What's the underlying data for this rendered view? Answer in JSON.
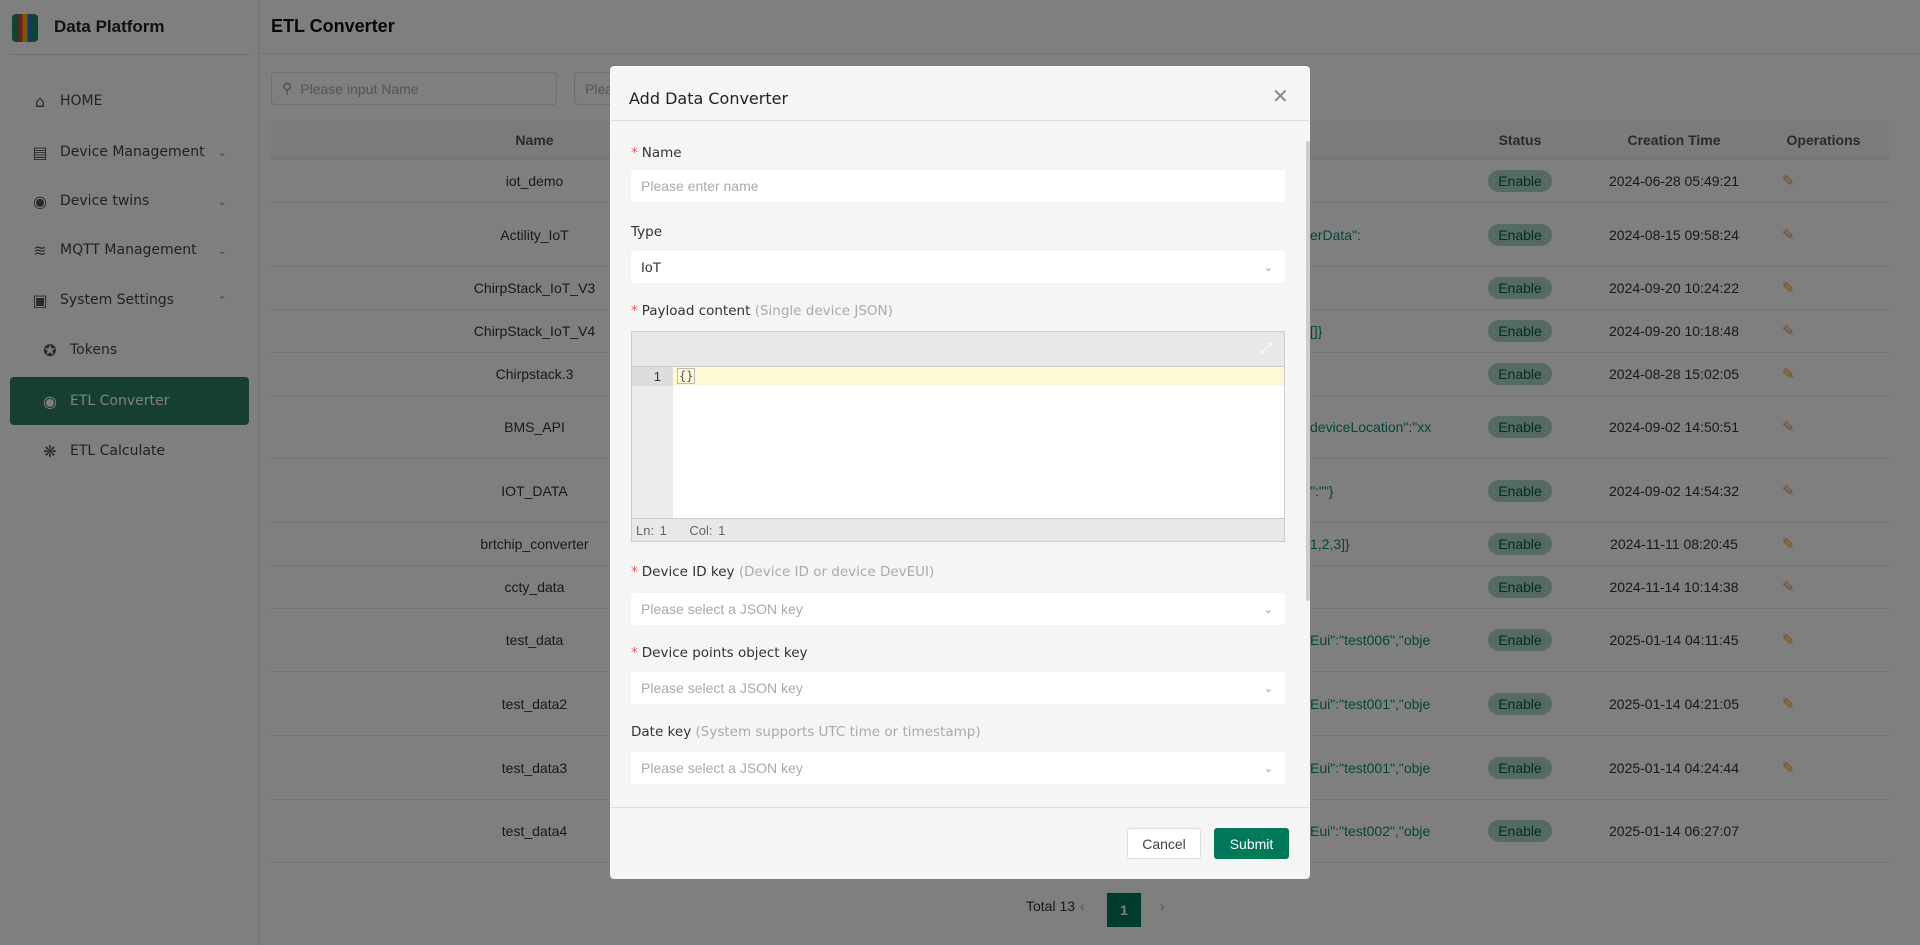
{
  "app": {
    "title": "Data Platform"
  },
  "sidebar": {
    "items": [
      {
        "label": "HOME",
        "icon": "home-icon"
      },
      {
        "label": "Device Management",
        "icon": "server-icon",
        "chevron": "down"
      },
      {
        "label": "Device twins",
        "icon": "cube-icon",
        "chevron": "down"
      },
      {
        "label": "MQTT Management",
        "icon": "router-icon",
        "chevron": "down"
      },
      {
        "label": "System Settings",
        "icon": "monitor-icon",
        "chevron": "up"
      },
      {
        "label": "Tokens",
        "icon": "star-badge-icon"
      },
      {
        "label": "ETL Converter",
        "icon": "cube-icon",
        "active": true
      },
      {
        "label": "ETL Calculate",
        "icon": "calculate-icon"
      }
    ]
  },
  "header": {
    "title": "ETL Converter"
  },
  "filters": {
    "search_placeholder": "Please input Name",
    "second_placeholder": "Plea"
  },
  "table": {
    "headers": [
      "Name",
      "",
      "Status",
      "Creation Time",
      "Operations"
    ],
    "rows": [
      {
        "name": "iot_demo",
        "payload": "",
        "status": "Enable",
        "time": "2024-06-28 05:49:21",
        "edit": true
      },
      {
        "name": "Actility_IoT",
        "payload": "erData\":",
        "status": "Enable",
        "time": "2024-08-15 09:58:24",
        "edit": true
      },
      {
        "name": "ChirpStack_IoT_V3",
        "payload": "",
        "status": "Enable",
        "time": "2024-09-20 10:24:22",
        "edit": true
      },
      {
        "name": "ChirpStack_IoT_V4",
        "payload": "[]}",
        "status": "Enable",
        "time": "2024-09-20 10:18:48",
        "edit": true
      },
      {
        "name": "Chirpstack.3",
        "payload": "",
        "status": "Enable",
        "time": "2024-08-28 15:02:05",
        "edit": true
      },
      {
        "name": "BMS_API",
        "payload": "deviceLocation\":\"xx",
        "status": "Enable",
        "time": "2024-09-02 14:50:51",
        "edit": true
      },
      {
        "name": "IOT_DATA",
        "payload": "\":\"\"}",
        "status": "Enable",
        "time": "2024-09-02 14:54:32",
        "edit": true
      },
      {
        "name": "brtchip_converter",
        "payload": "1,2,3]}",
        "status": "Enable",
        "time": "2024-11-11 08:20:45",
        "edit": true
      },
      {
        "name": "ccty_data",
        "payload": "",
        "status": "Enable",
        "time": "2024-11-14 10:14:38",
        "edit": true
      },
      {
        "name": "test_data",
        "payload": "Eui\":\"test006\",\"obje",
        "status": "Enable",
        "time": "2025-01-14 04:11:45",
        "edit": true
      },
      {
        "name": "test_data2",
        "payload": "Eui\":\"test001\",\"obje",
        "status": "Enable",
        "time": "2025-01-14 04:21:05",
        "edit": true
      },
      {
        "name": "test_data3",
        "payload": "Eui\":\"test001\",\"obje",
        "status": "Enable",
        "time": "2025-01-14 04:24:44",
        "edit": true
      },
      {
        "name": "test_data4",
        "payload": "Eui\":\"test002\",\"obje",
        "status": "Enable",
        "time": "2025-01-14 06:27:07",
        "edit": false
      }
    ]
  },
  "pagination": {
    "total": "Total 13",
    "current": "1"
  },
  "dialog": {
    "title": "Add Data Converter",
    "name": {
      "label": "Name",
      "placeholder": "Please enter name"
    },
    "type": {
      "label": "Type",
      "value": "IoT"
    },
    "payload": {
      "label": "Payload content",
      "hint": "(Single device JSON)",
      "line_number": "1",
      "code": "{}",
      "status": "Ln: 1    Col: 1"
    },
    "device_id": {
      "label": "Device ID key",
      "hint": "(Device ID or device DevEUI)",
      "placeholder": "Please select a JSON key"
    },
    "points": {
      "label": "Device points object key",
      "placeholder": "Please select a JSON key"
    },
    "date": {
      "label": "Date key",
      "hint": "(System supports UTC time or timestamp)",
      "placeholder": "Please select a JSON key"
    },
    "cancel": "Cancel",
    "submit": "Submit"
  },
  "colors": {
    "brand": "#00795a",
    "active_nav": "#2d7f5e",
    "required": "#e55555"
  }
}
